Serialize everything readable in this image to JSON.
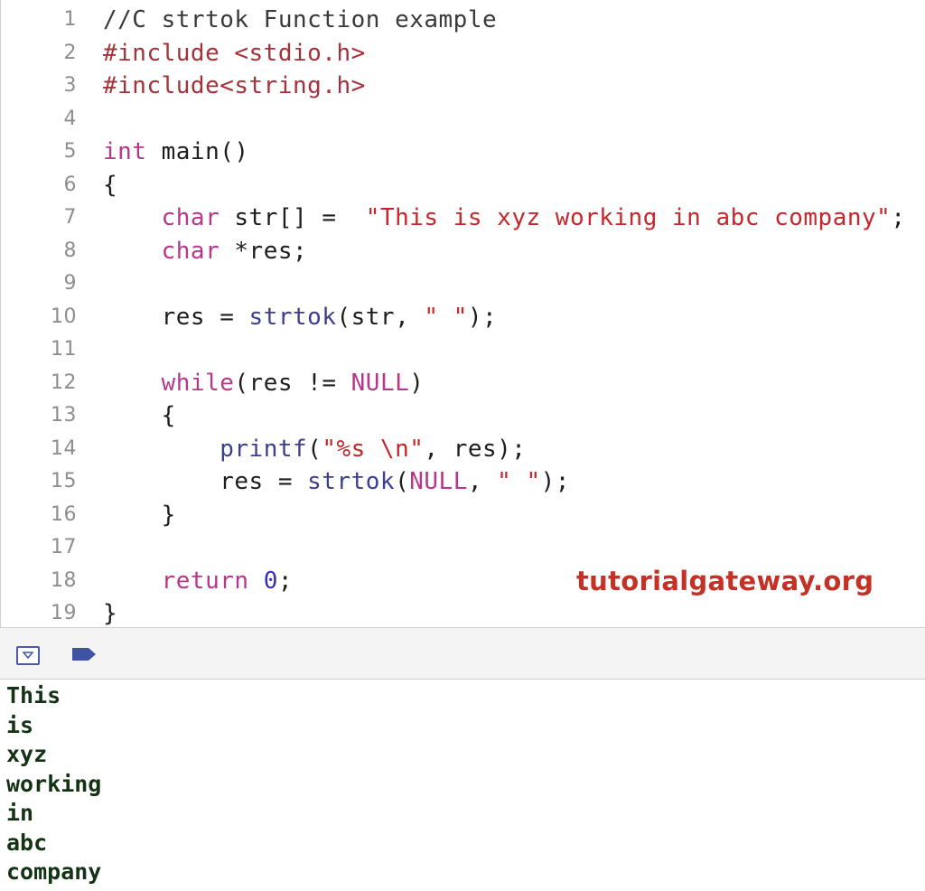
{
  "editor": {
    "lines": [
      {
        "num": "1",
        "tokens": [
          {
            "t": "//C strtok Function example",
            "k": "comment"
          }
        ]
      },
      {
        "num": "2",
        "tokens": [
          {
            "t": "#include <stdio.h>",
            "k": "pre"
          }
        ]
      },
      {
        "num": "3",
        "tokens": [
          {
            "t": "#include<string.h>",
            "k": "pre"
          }
        ]
      },
      {
        "num": "4",
        "tokens": []
      },
      {
        "num": "5",
        "tokens": [
          {
            "t": "int",
            "k": "kw"
          },
          {
            "t": " main()",
            "k": "plain"
          }
        ]
      },
      {
        "num": "6",
        "tokens": [
          {
            "t": "{",
            "k": "plain"
          }
        ]
      },
      {
        "num": "7",
        "tokens": [
          {
            "t": "    ",
            "k": "plain"
          },
          {
            "t": "char",
            "k": "kw"
          },
          {
            "t": " str[] =  ",
            "k": "plain"
          },
          {
            "t": "\"This is xyz working in abc company\"",
            "k": "str"
          },
          {
            "t": ";",
            "k": "plain"
          }
        ]
      },
      {
        "num": "8",
        "tokens": [
          {
            "t": "    ",
            "k": "plain"
          },
          {
            "t": "char",
            "k": "kw"
          },
          {
            "t": " *res;",
            "k": "plain"
          }
        ]
      },
      {
        "num": "9",
        "tokens": []
      },
      {
        "num": "10",
        "tokens": [
          {
            "t": "    res = ",
            "k": "plain"
          },
          {
            "t": "strtok",
            "k": "fn"
          },
          {
            "t": "(str, ",
            "k": "plain"
          },
          {
            "t": "\" \"",
            "k": "str"
          },
          {
            "t": ");",
            "k": "plain"
          }
        ]
      },
      {
        "num": "11",
        "tokens": []
      },
      {
        "num": "12",
        "tokens": [
          {
            "t": "    ",
            "k": "plain"
          },
          {
            "t": "while",
            "k": "kw"
          },
          {
            "t": "(res != ",
            "k": "plain"
          },
          {
            "t": "NULL",
            "k": "kw"
          },
          {
            "t": ")",
            "k": "plain"
          }
        ]
      },
      {
        "num": "13",
        "tokens": [
          {
            "t": "    {",
            "k": "plain"
          }
        ]
      },
      {
        "num": "14",
        "tokens": [
          {
            "t": "        ",
            "k": "plain"
          },
          {
            "t": "printf",
            "k": "fn"
          },
          {
            "t": "(",
            "k": "plain"
          },
          {
            "t": "\"%s \\n\"",
            "k": "str"
          },
          {
            "t": ", res);",
            "k": "plain"
          }
        ]
      },
      {
        "num": "15",
        "tokens": [
          {
            "t": "        res = ",
            "k": "plain"
          },
          {
            "t": "strtok",
            "k": "fn"
          },
          {
            "t": "(",
            "k": "plain"
          },
          {
            "t": "NULL",
            "k": "kw"
          },
          {
            "t": ", ",
            "k": "plain"
          },
          {
            "t": "\" \"",
            "k": "str"
          },
          {
            "t": ");",
            "k": "plain"
          }
        ]
      },
      {
        "num": "16",
        "tokens": [
          {
            "t": "    }",
            "k": "plain"
          }
        ]
      },
      {
        "num": "17",
        "tokens": []
      },
      {
        "num": "18",
        "tokens": [
          {
            "t": "    ",
            "k": "plain"
          },
          {
            "t": "return",
            "k": "kw"
          },
          {
            "t": " ",
            "k": "plain"
          },
          {
            "t": "0",
            "k": "num"
          },
          {
            "t": ";",
            "k": "plain"
          }
        ]
      },
      {
        "num": "19",
        "tokens": [
          {
            "t": "}",
            "k": "plain"
          }
        ]
      }
    ]
  },
  "watermark": "tutorialgateway.org",
  "debug_bar": {
    "icons": [
      "hide-debug-area-icon",
      "breakpoints-icon"
    ],
    "accent": "#4a5aa8"
  },
  "console": {
    "output": [
      "This",
      "is",
      "xyz",
      "working",
      "in",
      "abc",
      "company"
    ]
  }
}
